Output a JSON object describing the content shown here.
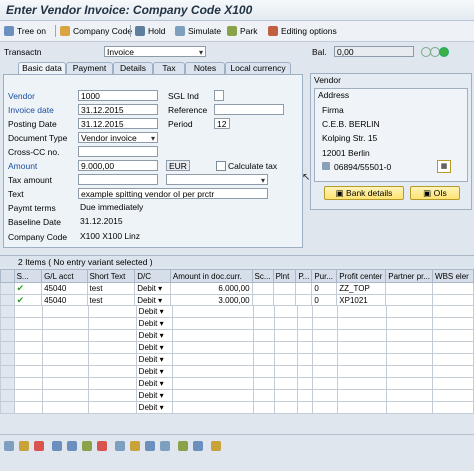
{
  "title": "Enter Vendor Invoice: Company Code X100",
  "toolbar": {
    "tree_on": "Tree on",
    "company_code": "Company Code",
    "hold": "Hold",
    "simulate": "Simulate",
    "park": "Park",
    "editing_options": "Editing options"
  },
  "transaction": {
    "label": "Transactn",
    "value": "Invoice"
  },
  "balance": {
    "label": "Bal.",
    "value": "0,00"
  },
  "tabs": [
    "Basic data",
    "Payment",
    "Details",
    "Tax",
    "Notes",
    "Local currency"
  ],
  "form": {
    "vendor_label": "Vendor",
    "vendor_value": "1000",
    "invoice_date_label": "Invoice date",
    "invoice_date_value": "31.12.2015",
    "posting_date_label": "Posting Date",
    "posting_date_value": "31.12.2015",
    "doc_type_label": "Document Type",
    "doc_type_value": "Vendor invoice",
    "cross_cc_label": "Cross-CC no.",
    "amount_label": "Amount",
    "amount_value": "9.000,00",
    "currency": "EUR",
    "calc_tax_label": "Calculate tax",
    "tax_amount_label": "Tax amount",
    "text_label": "Text",
    "text_value": "example spitting vendor oI per prctr",
    "paymt_terms_label": "Paymt terms",
    "paymt_terms_value": "Due immediately",
    "baseline_label": "Baseline Date",
    "baseline_value": "31.12.2015",
    "company_code_label": "Company Code",
    "company_code_value": "X100 X100 Linz",
    "sgl_label": "SGL Ind",
    "reference_label": "Reference",
    "period_label": "Period",
    "period_value": "12"
  },
  "vendor_panel": {
    "title": "Vendor",
    "address_title": "Address",
    "lines": [
      "Firma",
      "C.E.B. BERLIN",
      "Kolping Str. 15",
      "",
      "12001 Berlin"
    ],
    "phone": "06894/55501-0",
    "bank_details": "Bank details",
    "ois": "OIs"
  },
  "grid": {
    "header": "2 Items ( No entry variant selected )",
    "columns": [
      "S...",
      "G/L acct",
      "Short Text",
      "D/C",
      "Amount in doc.curr.",
      "Sc...",
      "Plnt",
      "P...",
      "Pur...",
      "Profit center",
      "Partner pr...",
      "WBS eler"
    ],
    "rows": [
      {
        "gl": "45040",
        "text": "test",
        "dc": "Debit",
        "amount": "6.000,00",
        "pur": "0",
        "pc": "ZZ_TOP"
      },
      {
        "gl": "45040",
        "text": "test",
        "dc": "Debit",
        "amount": "3.000,00",
        "pur": "0",
        "pc": "XP1021"
      }
    ],
    "empty_dc": "Debit"
  }
}
